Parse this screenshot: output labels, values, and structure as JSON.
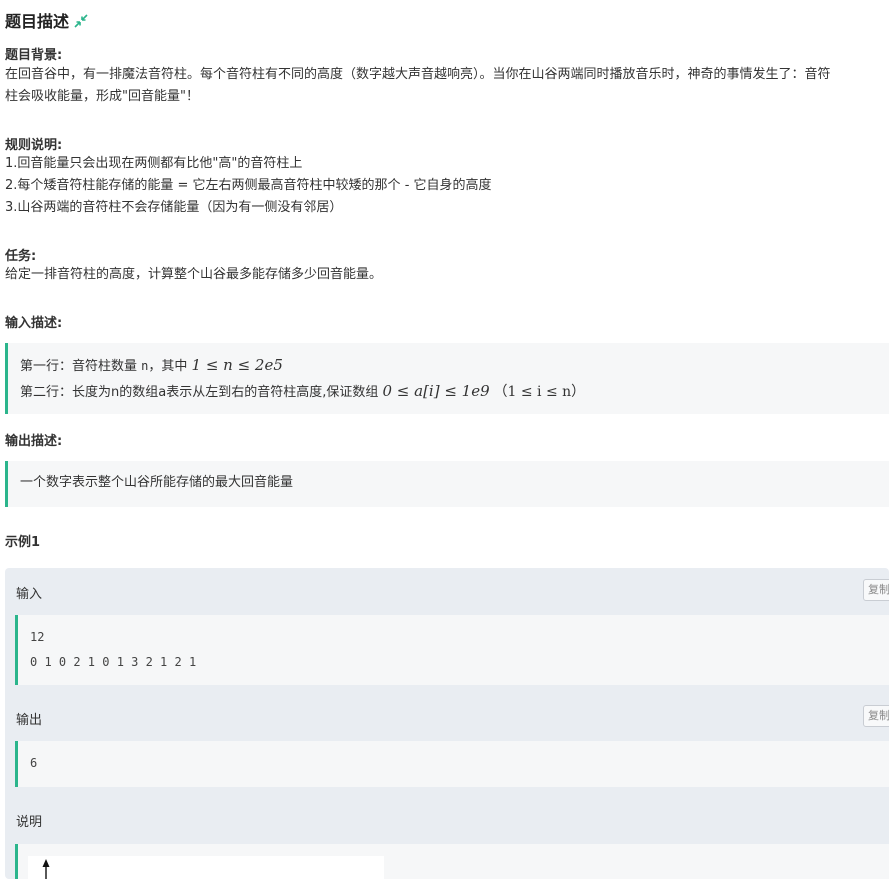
{
  "header": {
    "title": "题目描述",
    "collapse_icon": "collapse-arrows-icon"
  },
  "background": {
    "title": "题目背景:",
    "lines": [
      "在回音谷中，有一排魔法音符柱。每个音符柱有不同的高度（数字越大声音越响亮）。当你在山谷两端同时播放音乐时，神奇的事情发生了：音符",
      "柱会吸收能量，形成\"回音能量\"！"
    ]
  },
  "rules": {
    "title": "规则说明:",
    "lines": [
      "1.回音能量只会出现在两侧都有比他\"高\"的音符柱上",
      "2.每个矮音符柱能存储的能量 = 它左右两侧最高音符柱中较矮的那个 - 它自身的高度",
      "3.山谷两端的音符柱不会存储能量（因为有一侧没有邻居）"
    ]
  },
  "task": {
    "title": "任务:",
    "line": "给定一排音符柱的高度，计算整个山谷最多能存储多少回音能量。"
  },
  "input_desc": {
    "title": "输入描述:",
    "line1_prefix": "第一行：音符柱数量 ",
    "line1_var": "n",
    "line1_mid": "，其中 ",
    "line1_math": "1 ≤ n ≤ 2e5",
    "line2_prefix": "第二行：长度为n的数组a表示从左到右的音符柱高度,保证数组 ",
    "line2_math": "0 ≤ a[i] ≤ 1e9",
    "line2_suffix": "（1 ≤ i ≤ n）"
  },
  "output_desc": {
    "title": "输出描述:",
    "line": "一个数字表示整个山谷所能存储的最大回音能量"
  },
  "example": {
    "title": "示例1",
    "input_label": "输入",
    "copy_label": "复制",
    "input_lines": [
      "12",
      "0 1 0 2 1 0 1 3 2 1 2 1"
    ],
    "output_label": "输出",
    "output_lines": [
      "6"
    ],
    "explain_label": "说明"
  }
}
